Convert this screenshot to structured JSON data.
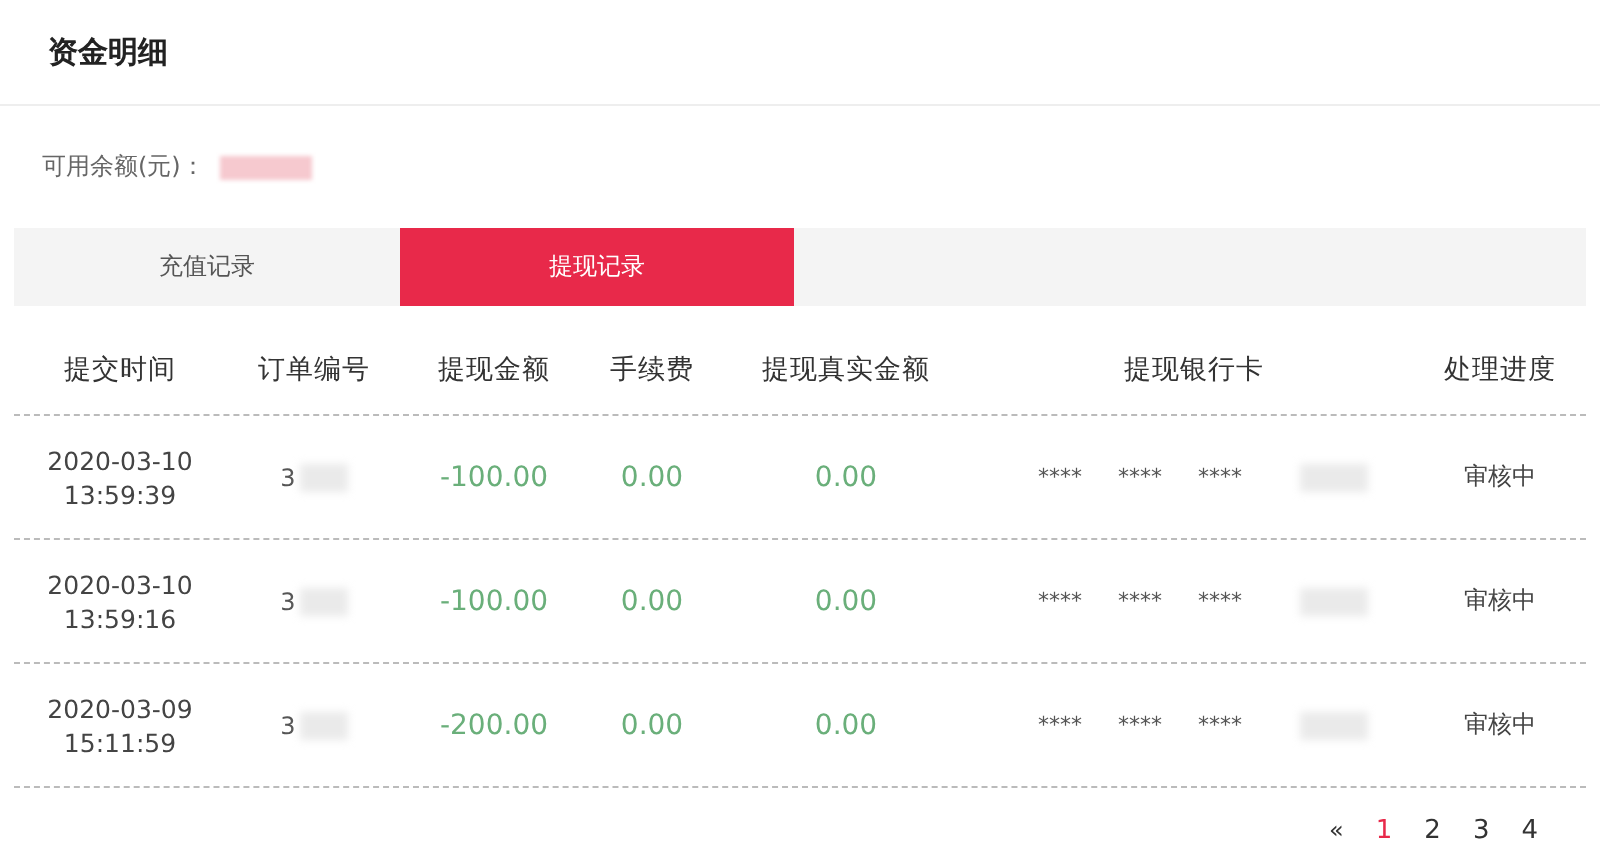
{
  "page": {
    "title": "资金明细"
  },
  "balance": {
    "label": "可用余额(元)："
  },
  "tabs": [
    {
      "label": "充值记录",
      "selected": false
    },
    {
      "label": "提现记录",
      "selected": true
    }
  ],
  "table": {
    "columns": [
      "提交时间",
      "订单编号",
      "提现金额",
      "手续费",
      "提现真实金额",
      "提现银行卡",
      "处理进度"
    ],
    "rows": [
      {
        "date": "2020-03-10",
        "time": "13:59:39",
        "order": "3",
        "amount": "-100.00",
        "fee": "0.00",
        "real": "0.00",
        "card": [
          "****",
          "****",
          "****"
        ],
        "status": "审核中"
      },
      {
        "date": "2020-03-10",
        "time": "13:59:16",
        "order": "3",
        "amount": "-100.00",
        "fee": "0.00",
        "real": "0.00",
        "card": [
          "****",
          "****",
          "****"
        ],
        "status": "审核中"
      },
      {
        "date": "2020-03-09",
        "time": "15:11:59",
        "order": "3",
        "amount": "-200.00",
        "fee": "0.00",
        "real": "0.00",
        "card": [
          "****",
          "****",
          "****"
        ],
        "status": "审核中"
      }
    ]
  },
  "pagination": {
    "prev": "«",
    "pages": [
      {
        "label": "1",
        "selected": true
      },
      {
        "label": "2",
        "selected": false
      },
      {
        "label": "3",
        "selected": false
      },
      {
        "label": "4",
        "selected": false
      }
    ]
  }
}
